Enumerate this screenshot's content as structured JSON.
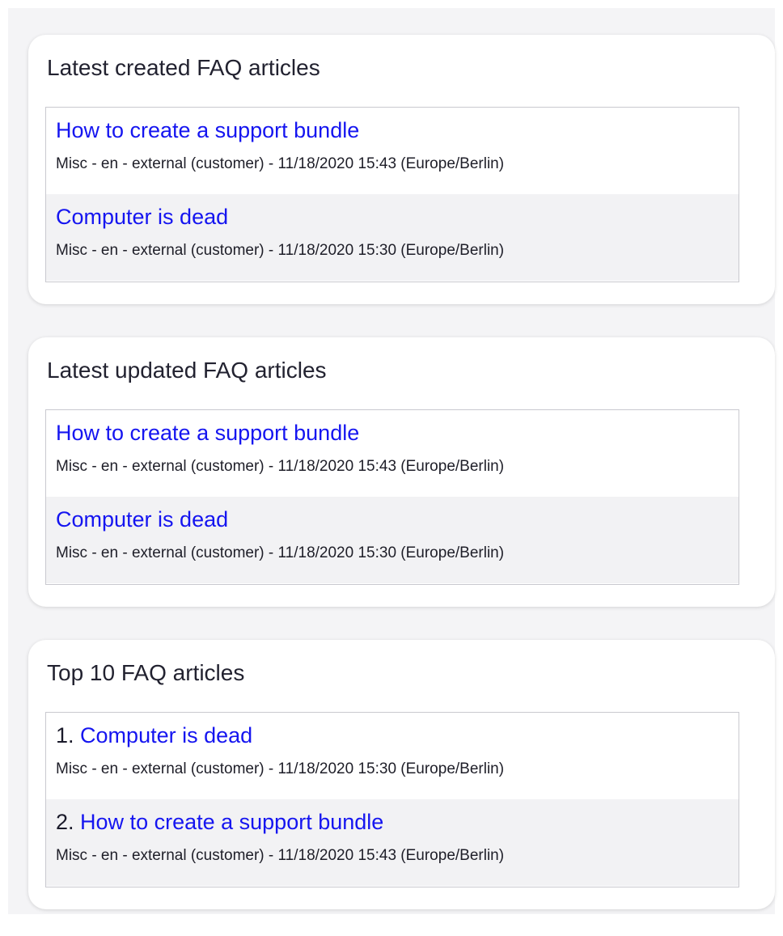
{
  "widgets": [
    {
      "title": "Latest created FAQ articles",
      "articles": [
        {
          "rank": "",
          "title": "How to create a support bundle",
          "meta": "Misc - en - external (customer) - 11/18/2020 15:43 (Europe/Berlin)"
        },
        {
          "rank": "",
          "title": "Computer is dead",
          "meta": "Misc - en - external (customer) - 11/18/2020 15:30 (Europe/Berlin)"
        }
      ]
    },
    {
      "title": "Latest updated FAQ articles",
      "articles": [
        {
          "rank": "",
          "title": "How to create a support bundle",
          "meta": "Misc - en - external (customer) - 11/18/2020 15:43 (Europe/Berlin)"
        },
        {
          "rank": "",
          "title": "Computer is dead",
          "meta": "Misc - en - external (customer) - 11/18/2020 15:30 (Europe/Berlin)"
        }
      ]
    },
    {
      "title": "Top 10 FAQ articles",
      "articles": [
        {
          "rank": "1.",
          "title": "Computer is dead",
          "meta": "Misc - en - external (customer) - 11/18/2020 15:30 (Europe/Berlin)"
        },
        {
          "rank": "2.",
          "title": "How to create a support bundle",
          "meta": "Misc - en - external (customer) - 11/18/2020 15:43 (Europe/Berlin)"
        }
      ]
    }
  ],
  "colors": {
    "page_background": "#f4f4f6",
    "widget_background": "#ffffff",
    "link": "#1515f0",
    "alt_row": "#f2f2f4",
    "list_border": "#c9c9cf"
  }
}
